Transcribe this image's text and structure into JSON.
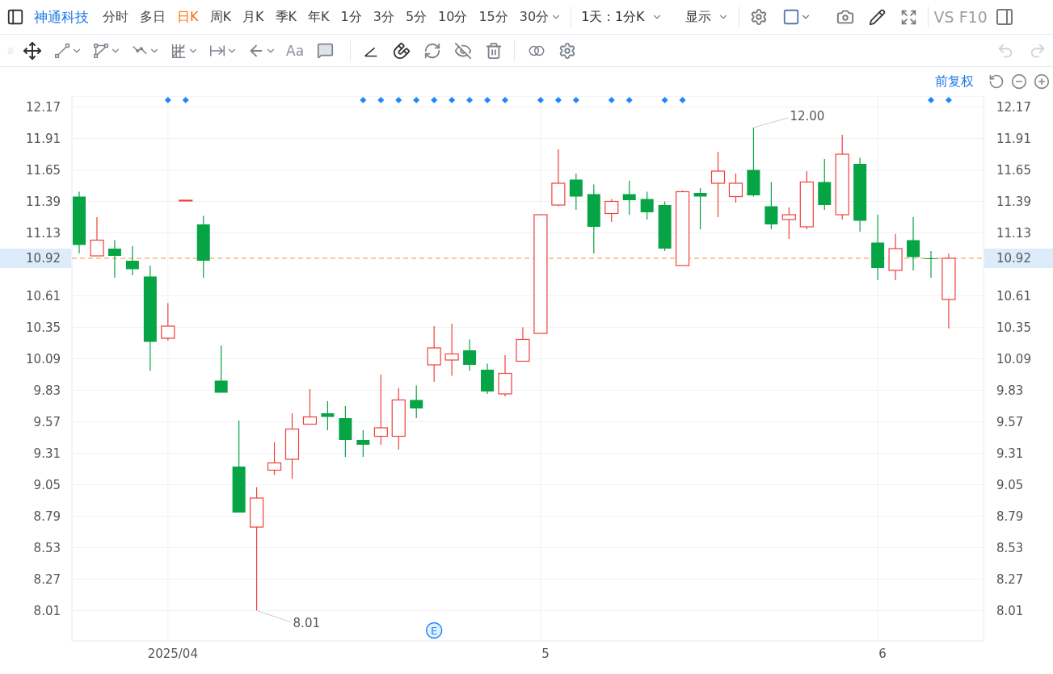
{
  "top_toolbar": {
    "stock_name": "神通科技",
    "period_tabs": [
      {
        "label": "分时",
        "selected": false,
        "dropdown": false
      },
      {
        "label": "多日",
        "selected": false,
        "dropdown": false
      },
      {
        "label": "日K",
        "selected": true,
        "dropdown": false
      },
      {
        "label": "周K",
        "selected": false,
        "dropdown": false
      },
      {
        "label": "月K",
        "selected": false,
        "dropdown": false
      },
      {
        "label": "季K",
        "selected": false,
        "dropdown": false
      },
      {
        "label": "年K",
        "selected": false,
        "dropdown": false
      },
      {
        "label": "1分",
        "selected": false,
        "dropdown": false
      },
      {
        "label": "3分",
        "selected": false,
        "dropdown": false
      },
      {
        "label": "5分",
        "selected": false,
        "dropdown": false
      },
      {
        "label": "10分",
        "selected": false,
        "dropdown": false
      },
      {
        "label": "15分",
        "selected": false,
        "dropdown": false
      },
      {
        "label": "30分",
        "selected": false,
        "dropdown": true
      }
    ],
    "range_menu": "1天 : 1分K",
    "display_menu": "显示",
    "compare": "VS",
    "f10": "F10"
  },
  "drawing_toolbar": {
    "text_tool": "Aa",
    "undo_disabled": true,
    "redo_disabled": true
  },
  "chart_header": {
    "adjustment": "前复权"
  },
  "left_axis": {
    "last_price_label": "10.92"
  },
  "right_axis": {
    "labels": [
      "12.17",
      "11.91",
      "11.65",
      "11.39",
      "11.13",
      "10.61",
      "10.35",
      "10.09",
      "9.83",
      "9.57",
      "9.31",
      "9.05",
      "8.79",
      "8.53",
      "8.27",
      "8.01"
    ]
  },
  "event_markers": [
    false,
    false,
    false,
    false,
    false,
    true,
    true,
    false,
    false,
    false,
    false,
    false,
    false,
    false,
    false,
    false,
    true,
    true,
    true,
    true,
    true,
    true,
    true,
    true,
    true,
    false,
    true,
    true,
    true,
    false,
    true,
    true,
    false,
    true,
    true,
    false,
    false,
    false,
    false,
    false,
    false,
    false,
    false,
    false,
    false,
    false,
    false,
    false,
    true,
    true
  ],
  "event_badge": {
    "label": "E"
  },
  "chart_data": {
    "type": "candlestick",
    "grid": true,
    "categories": [
      null,
      null,
      null,
      null,
      null,
      "2025/04",
      null,
      null,
      null,
      null,
      null,
      null,
      null,
      null,
      null,
      null,
      null,
      null,
      null,
      null,
      null,
      null,
      null,
      null,
      null,
      null,
      "5",
      null,
      null,
      null,
      null,
      null,
      null,
      null,
      null,
      null,
      null,
      null,
      null,
      null,
      null,
      null,
      null,
      null,
      null,
      "6",
      null,
      null,
      null,
      null
    ],
    "ylim": [
      7.76,
      12.26
    ],
    "yticks": [
      {
        "value": 12.17,
        "label": "12.17"
      },
      {
        "value": 11.91,
        "label": "11.91"
      },
      {
        "value": 11.65,
        "label": "11.65"
      },
      {
        "value": 11.39,
        "label": "11.39"
      },
      {
        "value": 11.13,
        "label": "11.13"
      },
      {
        "value": 10.61,
        "label": "10.61"
      },
      {
        "value": 10.35,
        "label": "10.35"
      },
      {
        "value": 10.09,
        "label": "10.09"
      },
      {
        "value": 9.83,
        "label": "9.83"
      },
      {
        "value": 9.57,
        "label": "9.57"
      },
      {
        "value": 9.31,
        "label": "9.31"
      },
      {
        "value": 9.05,
        "label": "9.05"
      },
      {
        "value": 8.79,
        "label": "8.79"
      },
      {
        "value": 8.53,
        "label": "8.53"
      },
      {
        "value": 8.27,
        "label": "8.27"
      },
      {
        "value": 8.01,
        "label": "8.01"
      }
    ],
    "ohlc": [
      [
        11.43,
        11.47,
        10.96,
        11.03
      ],
      [
        10.94,
        11.26,
        10.94,
        11.07
      ],
      [
        11.0,
        11.07,
        10.76,
        10.94
      ],
      [
        10.9,
        11.02,
        10.78,
        10.83
      ],
      [
        10.77,
        10.86,
        9.99,
        10.23
      ],
      [
        10.26,
        10.55,
        10.24,
        10.36
      ],
      [
        11.4,
        11.4,
        11.4,
        11.4
      ],
      [
        11.2,
        11.27,
        10.76,
        10.9
      ],
      [
        9.91,
        10.2,
        9.81,
        9.81
      ],
      [
        9.2,
        9.58,
        8.82,
        8.82
      ],
      [
        8.7,
        9.03,
        8.01,
        8.94
      ],
      [
        9.17,
        9.4,
        9.13,
        9.23
      ],
      [
        9.26,
        9.64,
        9.1,
        9.51
      ],
      [
        9.55,
        9.84,
        9.55,
        9.61
      ],
      [
        9.64,
        9.74,
        9.5,
        9.61
      ],
      [
        9.6,
        9.7,
        9.28,
        9.42
      ],
      [
        9.42,
        9.5,
        9.28,
        9.38
      ],
      [
        9.45,
        9.96,
        9.38,
        9.52
      ],
      [
        9.45,
        9.85,
        9.34,
        9.75
      ],
      [
        9.75,
        9.87,
        9.6,
        9.68
      ],
      [
        10.04,
        10.36,
        9.9,
        10.18
      ],
      [
        10.08,
        10.38,
        9.95,
        10.13
      ],
      [
        10.16,
        10.25,
        9.99,
        10.04
      ],
      [
        10.0,
        10.05,
        9.8,
        9.82
      ],
      [
        9.8,
        10.12,
        9.78,
        9.97
      ],
      [
        10.07,
        10.35,
        10.07,
        10.25
      ],
      [
        10.3,
        11.28,
        10.3,
        11.28
      ],
      [
        11.36,
        11.82,
        11.35,
        11.54
      ],
      [
        11.57,
        11.62,
        11.32,
        11.43
      ],
      [
        11.45,
        11.53,
        10.96,
        11.18
      ],
      [
        11.29,
        11.41,
        11.22,
        11.39
      ],
      [
        11.45,
        11.56,
        11.28,
        11.4
      ],
      [
        11.41,
        11.47,
        11.24,
        11.3
      ],
      [
        11.36,
        11.39,
        10.98,
        11.0
      ],
      [
        10.86,
        11.48,
        10.86,
        11.47
      ],
      [
        11.46,
        11.5,
        11.16,
        11.43
      ],
      [
        11.54,
        11.8,
        11.26,
        11.64
      ],
      [
        11.43,
        11.62,
        11.38,
        11.54
      ],
      [
        11.65,
        12.0,
        11.43,
        11.44
      ],
      [
        11.35,
        11.55,
        11.16,
        11.2
      ],
      [
        11.24,
        11.34,
        11.08,
        11.28
      ],
      [
        11.18,
        11.64,
        11.16,
        11.55
      ],
      [
        11.55,
        11.74,
        11.32,
        11.36
      ],
      [
        11.28,
        11.94,
        11.24,
        11.78
      ],
      [
        11.7,
        11.75,
        11.14,
        11.23
      ],
      [
        11.05,
        11.28,
        10.74,
        10.84
      ],
      [
        10.82,
        11.12,
        10.74,
        11.0
      ],
      [
        11.07,
        11.26,
        10.82,
        10.93
      ],
      [
        10.92,
        10.98,
        10.76,
        10.92
      ],
      [
        10.58,
        10.96,
        10.34,
        10.92
      ]
    ],
    "ref_lines": [
      {
        "axis": "y",
        "value": 10.92,
        "label": "10.92"
      }
    ],
    "annotations": [
      "12.00",
      "8.01"
    ]
  }
}
